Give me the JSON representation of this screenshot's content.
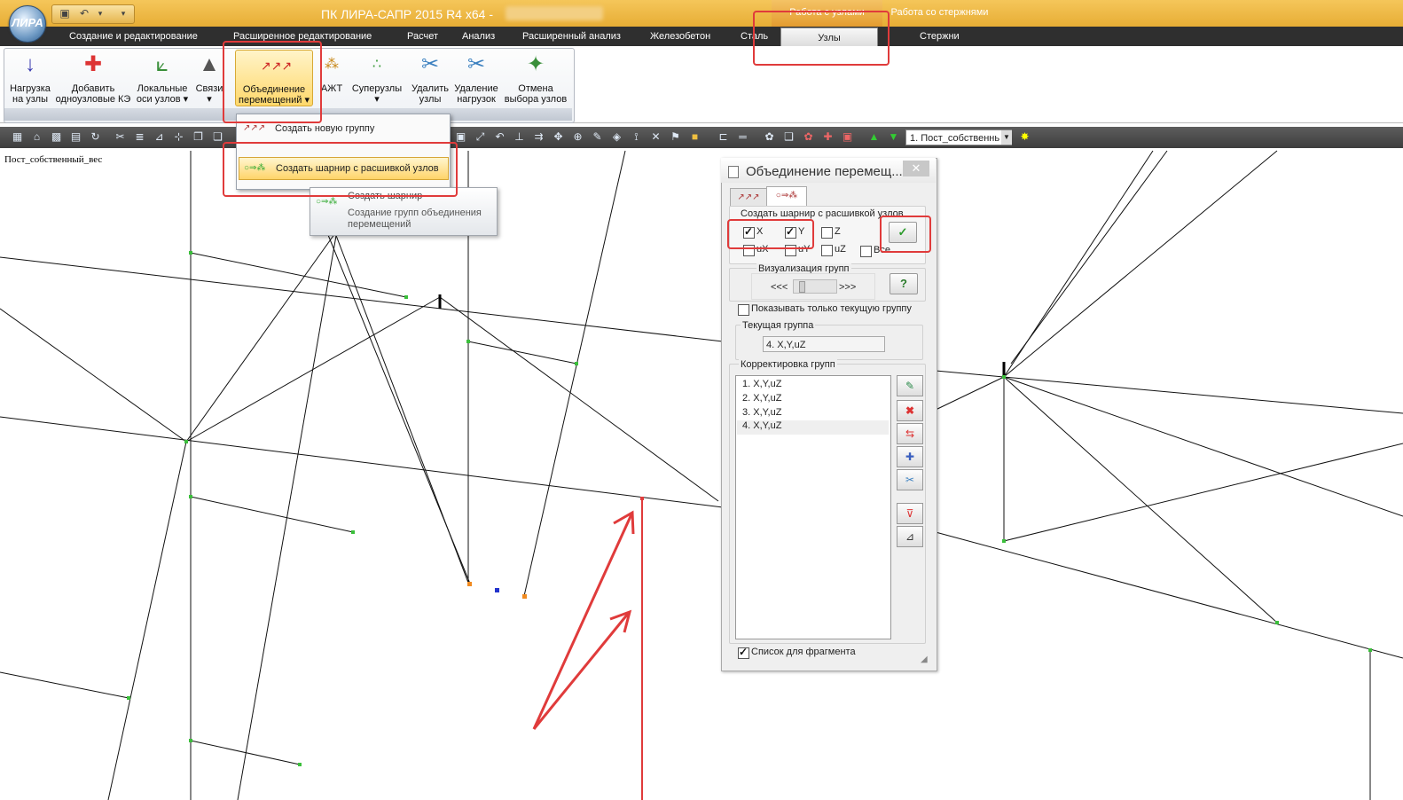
{
  "app": {
    "title": "ПК ЛИРА-САПР  2015 R4 x64 -",
    "logo_text": "ЛИРА",
    "context_groups": [
      "Работа с узлами",
      "Работа со стержнями"
    ]
  },
  "tabs": [
    "Создание и редактирование",
    "Расширенное редактирование",
    "Расчет",
    "Анализ",
    "Расширенный анализ",
    "Железобетон",
    "Сталь",
    "Узлы",
    "Стержни"
  ],
  "ribbon": {
    "buttons": [
      {
        "label1": "Нагрузка",
        "label2": "на узлы",
        "icon": "node-load-icon"
      },
      {
        "label1": "Добавить",
        "label2": "одноузловые КЭ",
        "icon": "add-single-node-fe-icon"
      },
      {
        "label1": "Локальные",
        "label2": "оси узлов ▾",
        "icon": "local-axes-icon"
      },
      {
        "label1": "Связи",
        "label2": "▾",
        "icon": "supports-icon"
      },
      {
        "label1": "Объединение",
        "label2": "перемещений ▾",
        "icon": "displacement-union-icon"
      },
      {
        "label1": "АЖТ",
        "label2": "",
        "icon": "rigid-body-icon"
      },
      {
        "label1": "Суперузлы",
        "label2": "▾",
        "icon": "supernodes-icon"
      },
      {
        "label1": "Удалить",
        "label2": "узлы",
        "icon": "delete-nodes-icon"
      },
      {
        "label1": "Удаление",
        "label2": "нагрузок",
        "icon": "delete-loads-icon"
      },
      {
        "label1": "Отмена",
        "label2": "выбора узлов",
        "icon": "deselect-nodes-icon"
      }
    ]
  },
  "toolbar": {
    "load_case": "1. Пост_собственнь"
  },
  "canvas": {
    "case_label": "Пост_собственный_вес"
  },
  "dropdown": {
    "items": [
      {
        "label": "Создать новую группу",
        "icon": "new-group-icon"
      },
      {
        "label": "Создать шарнир с расшивкой узлов",
        "icon": "create-hinge-icon"
      }
    ]
  },
  "tooltip": {
    "title": "Создать шарнир",
    "description": "Создание групп объединения перемещений"
  },
  "dialog": {
    "title": "Объединение перемещ...",
    "close": "✕",
    "section_label": "Создать шарнир с расшивкой узлов",
    "checkboxes": [
      {
        "label": "X",
        "checked": true
      },
      {
        "label": "Y",
        "checked": true
      },
      {
        "label": "Z",
        "checked": false
      },
      {
        "label": "uX",
        "checked": false
      },
      {
        "label": "uY",
        "checked": false
      },
      {
        "label": "uZ",
        "checked": false
      },
      {
        "label": "Все",
        "checked": false
      }
    ],
    "apply_icon": "✓",
    "viz_label": "Визуализация групп",
    "viz_left": "<<<",
    "viz_right": ">>>",
    "help": "?",
    "show_current_only": "Показывать только текущую группу",
    "current_group_label": "Текущая группа",
    "current_group_value": "4. X,Y,uZ",
    "edit_groups_label": "Корректировка групп",
    "groups": [
      "1. X,Y,uZ",
      "2. X,Y,uZ",
      "3. X,Y,uZ",
      "4. X,Y,uZ"
    ],
    "list_for_fragment": "Список для фрагмента",
    "list_for_fragment_checked": true
  },
  "colors": {
    "titlebar": "#f0b94a",
    "annotation_red": "#e03b3b",
    "node_green": "#3bbf3b",
    "node_orange": "#f08a20"
  }
}
